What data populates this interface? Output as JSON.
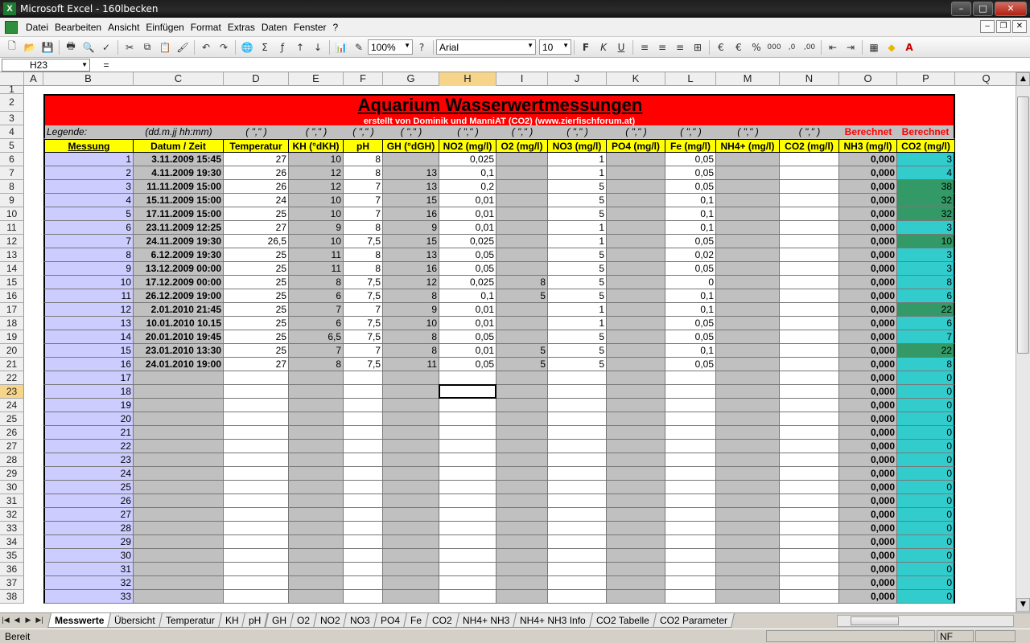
{
  "window": {
    "title": "Microsoft Excel - 160lbecken",
    "app_icon_letter": "X",
    "buttons": [
      "–",
      "□",
      "✕"
    ]
  },
  "menu": {
    "items": [
      "Datei",
      "Bearbeiten",
      "Ansicht",
      "Einfügen",
      "Format",
      "Extras",
      "Daten",
      "Fenster",
      "?"
    ]
  },
  "toolbar": {
    "zoom": "100%",
    "font": "Arial",
    "font_size": "10",
    "help_glyph": "?"
  },
  "formula": {
    "cell_ref": "H23",
    "equals": "=",
    "content": ""
  },
  "columns": [
    {
      "name": "A",
      "w": 24
    },
    {
      "name": "B",
      "w": 112
    },
    {
      "name": "C",
      "w": 112
    },
    {
      "name": "D",
      "w": 81
    },
    {
      "name": "E",
      "w": 68
    },
    {
      "name": "F",
      "w": 49
    },
    {
      "name": "G",
      "w": 70
    },
    {
      "name": "H",
      "w": 71
    },
    {
      "name": "I",
      "w": 64
    },
    {
      "name": "J",
      "w": 73
    },
    {
      "name": "K",
      "w": 73
    },
    {
      "name": "L",
      "w": 63
    },
    {
      "name": "M",
      "w": 79
    },
    {
      "name": "N",
      "w": 74
    },
    {
      "name": "O",
      "w": 72
    },
    {
      "name": "P",
      "w": 72
    },
    {
      "name": "Q",
      "w": 78
    }
  ],
  "row_numbers": [
    1,
    2,
    3,
    4,
    5,
    6,
    7,
    8,
    9,
    10,
    11,
    12,
    13,
    14,
    15,
    16,
    17,
    18,
    19,
    20,
    21,
    22,
    23,
    24,
    25,
    26,
    27,
    28,
    29,
    30,
    31,
    32,
    33,
    34,
    35,
    36,
    37,
    38
  ],
  "selected": {
    "col": "H",
    "row": 23
  },
  "sheet": {
    "title": "Aquarium Wasserwertmessungen",
    "subtitle": "erstellt von Dominik und ManniAT (CO2) (www.zierfischforum.at)",
    "legend_label": "Legende:",
    "legend_date": "(dd.m.jj hh:mm)",
    "legend_format": "( \",\" )",
    "calculated": "Berechnet",
    "headers": [
      "Messung",
      "Datum / Zeit",
      "Temperatur",
      "KH (°dKH)",
      "pH",
      "GH (°dGH)",
      "NO2 (mg/l)",
      "O2 (mg/l)",
      "NO3 (mg/l)",
      "PO4 (mg/l)",
      "Fe (mg/l)",
      "NH4+ (mg/l)",
      "CO2 (mg/l)",
      "NH3 (mg/l)",
      "CO2 (mg/l)"
    ],
    "rows": [
      [
        "1",
        "3.11.2009 15:45",
        "27",
        "10",
        "8",
        "",
        "0,025",
        "",
        "1",
        "",
        "0,05",
        "",
        "",
        "0,000",
        "3"
      ],
      [
        "2",
        "4.11.2009 19:30",
        "26",
        "12",
        "8",
        "13",
        "0,1",
        "",
        "1",
        "",
        "0,05",
        "",
        "",
        "0,000",
        "4"
      ],
      [
        "3",
        "11.11.2009 15:00",
        "26",
        "12",
        "7",
        "13",
        "0,2",
        "",
        "5",
        "",
        "0,05",
        "",
        "",
        "0,000",
        "38"
      ],
      [
        "4",
        "15.11.2009 15:00",
        "24",
        "10",
        "7",
        "15",
        "0,01",
        "",
        "5",
        "",
        "0,1",
        "",
        "",
        "0,000",
        "32"
      ],
      [
        "5",
        "17.11.2009 15:00",
        "25",
        "10",
        "7",
        "16",
        "0,01",
        "",
        "5",
        "",
        "0,1",
        "",
        "",
        "0,000",
        "32"
      ],
      [
        "6",
        "23.11.2009 12:25",
        "27",
        "9",
        "8",
        "9",
        "0,01",
        "",
        "1",
        "",
        "0,1",
        "",
        "",
        "0,000",
        "3"
      ],
      [
        "7",
        "24.11.2009 19:30",
        "26,5",
        "10",
        "7,5",
        "15",
        "0,025",
        "",
        "1",
        "",
        "0,05",
        "",
        "",
        "0,000",
        "10"
      ],
      [
        "8",
        "6.12.2009 19:30",
        "25",
        "11",
        "8",
        "13",
        "0,05",
        "",
        "5",
        "",
        "0,02",
        "",
        "",
        "0,000",
        "3"
      ],
      [
        "9",
        "13.12.2009 00:00",
        "25",
        "11",
        "8",
        "16",
        "0,05",
        "",
        "5",
        "",
        "0,05",
        "",
        "",
        "0,000",
        "3"
      ],
      [
        "10",
        "17.12.2009 00:00",
        "25",
        "8",
        "7,5",
        "12",
        "0,025",
        "8",
        "5",
        "",
        "0",
        "",
        "",
        "0,000",
        "8"
      ],
      [
        "11",
        "26.12.2009 19:00",
        "25",
        "6",
        "7,5",
        "8",
        "0,1",
        "5",
        "5",
        "",
        "0,1",
        "",
        "",
        "0,000",
        "6"
      ],
      [
        "12",
        "2.01.2010 21:45",
        "25",
        "7",
        "7",
        "9",
        "0,01",
        "",
        "1",
        "",
        "0,1",
        "",
        "",
        "0,000",
        "22"
      ],
      [
        "13",
        "10.01.2010 10.15",
        "25",
        "6",
        "7,5",
        "10",
        "0,01",
        "",
        "1",
        "",
        "0,05",
        "",
        "",
        "0,000",
        "6"
      ],
      [
        "14",
        "20.01.2010 19:45",
        "25",
        "6,5",
        "7,5",
        "8",
        "0,05",
        "",
        "5",
        "",
        "0,05",
        "",
        "",
        "0,000",
        "7"
      ],
      [
        "15",
        "23.01.2010 13:30",
        "25",
        "7",
        "7",
        "8",
        "0,01",
        "5",
        "5",
        "",
        "0,1",
        "",
        "",
        "0,000",
        "22"
      ],
      [
        "16",
        "24.01.2010 19:00",
        "27",
        "8",
        "7,5",
        "11",
        "0,05",
        "5",
        "5",
        "",
        "0,05",
        "",
        "",
        "0,000",
        "8"
      ]
    ],
    "empty_rows_start": 17,
    "empty_rows_end": 33,
    "empty_nh3": "0,000",
    "empty_co2": "0"
  },
  "colors": {
    "title_bg": "#ff0000",
    "header_bg": "#ffff00",
    "messung_bg": "#ccccff",
    "date_bg": "#c0c0c0",
    "gray_col": "#c0c0c0",
    "co2_teal": "#33cccc",
    "co2_green": "#339966",
    "calc_red": "#ff0000"
  },
  "tabs": [
    "Messwerte",
    "Übersicht",
    "Temperatur",
    "KH",
    "pH",
    "GH",
    "O2",
    "NO2",
    "NO3",
    "PO4",
    "Fe",
    "CO2",
    "NH4+ NH3",
    "NH4+ NH3 Info",
    "CO2 Tabelle",
    "CO2 Parameter"
  ],
  "active_tab": "Messwerte",
  "status": {
    "text": "Bereit",
    "nf": "NF"
  }
}
